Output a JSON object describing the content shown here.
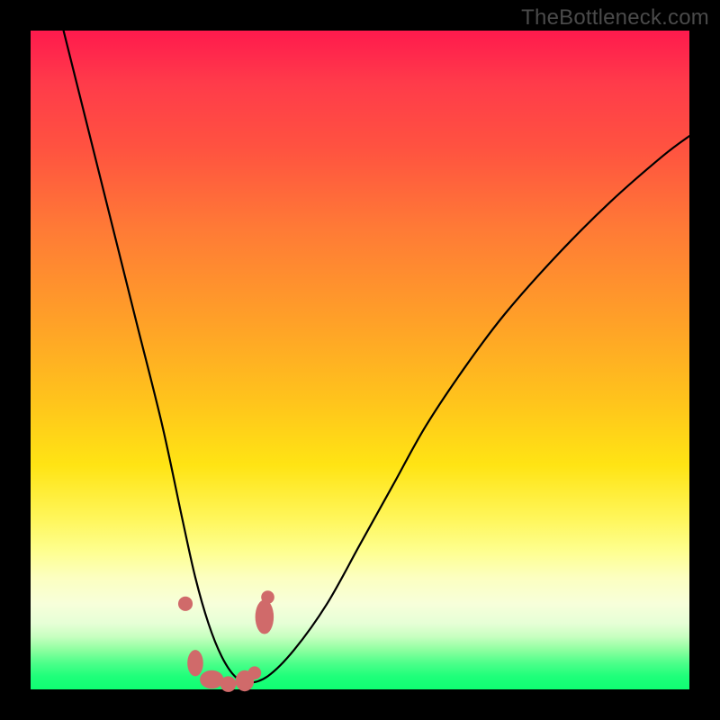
{
  "attribution": "TheBottleneck.com",
  "colors": {
    "frame": "#000000",
    "curve": "#000000",
    "marker": "#d06a6a",
    "gradient_top": "#ff1a4d",
    "gradient_bottom": "#0fff72"
  },
  "chart_data": {
    "type": "line",
    "title": "",
    "xlabel": "",
    "ylabel": "",
    "x_range": [
      0,
      100
    ],
    "y_range": [
      0,
      100
    ],
    "series": [
      {
        "name": "bottleneck-curve",
        "x": [
          5,
          8,
          12,
          16,
          20,
          23,
          25,
          27,
          29,
          31,
          33,
          36,
          40,
          45,
          50,
          55,
          60,
          66,
          72,
          80,
          88,
          96,
          100
        ],
        "y": [
          100,
          88,
          72,
          56,
          40,
          26,
          17,
          10,
          5,
          2,
          1,
          2,
          6,
          13,
          22,
          31,
          40,
          49,
          57,
          66,
          74,
          81,
          84
        ]
      }
    ],
    "markers": [
      {
        "shape": "circle",
        "x": 23.5,
        "y": 13,
        "r": 1.1
      },
      {
        "shape": "oval",
        "x": 25.0,
        "y": 4,
        "rx": 1.2,
        "ry": 2.0
      },
      {
        "shape": "oval",
        "x": 27.5,
        "y": 1.5,
        "rx": 1.8,
        "ry": 1.4
      },
      {
        "shape": "circle",
        "x": 30.0,
        "y": 0.8,
        "r": 1.2
      },
      {
        "shape": "oval",
        "x": 32.5,
        "y": 1.3,
        "rx": 1.4,
        "ry": 1.6
      },
      {
        "shape": "circle",
        "x": 34.0,
        "y": 2.5,
        "r": 1.0
      },
      {
        "shape": "oval",
        "x": 35.5,
        "y": 11,
        "rx": 1.4,
        "ry": 2.6
      },
      {
        "shape": "circle",
        "x": 36.0,
        "y": 14,
        "r": 1.0
      }
    ],
    "annotations": []
  }
}
